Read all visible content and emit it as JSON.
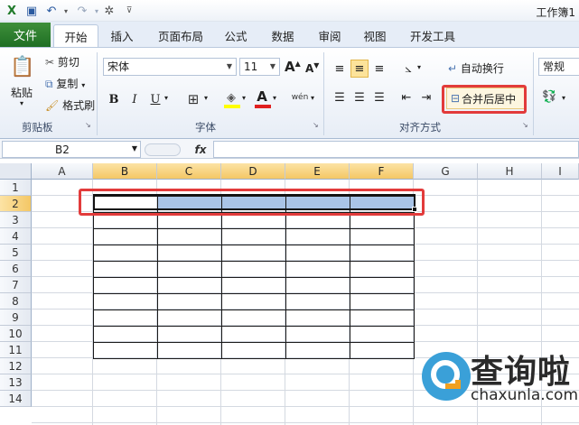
{
  "window": {
    "title": "工作簿1"
  },
  "tabs": [
    {
      "label": "文件"
    },
    {
      "label": "开始"
    },
    {
      "label": "插入"
    },
    {
      "label": "页面布局"
    },
    {
      "label": "公式"
    },
    {
      "label": "数据"
    },
    {
      "label": "审阅"
    },
    {
      "label": "视图"
    },
    {
      "label": "开发工具"
    }
  ],
  "clipboard": {
    "paste_label": "粘贴",
    "cut_label": "剪切",
    "copy_label": "复制",
    "format_painter_label": "格式刷",
    "group_label": "剪贴板"
  },
  "font": {
    "name_value": "宋体",
    "size_value": "11",
    "bold": "B",
    "italic": "I",
    "underline": "U",
    "grow": "A",
    "shrink": "A",
    "font_color_glyph": "A",
    "phonetic_glyph": "wén",
    "group_label": "字体"
  },
  "alignment": {
    "wrap_text_label": "自动换行",
    "merge_center_label": "合并后居中",
    "group_label": "对齐方式"
  },
  "number": {
    "format_value": "常规"
  },
  "formula_bar": {
    "name_box_value": "B2",
    "fx_label": "fx",
    "formula_value": ""
  },
  "grid": {
    "columns": [
      "A",
      "B",
      "C",
      "D",
      "E",
      "F",
      "G",
      "H",
      "I"
    ],
    "selected_columns": [
      "B",
      "C",
      "D",
      "E",
      "F"
    ],
    "rows": [
      "1",
      "2",
      "3",
      "4",
      "5",
      "6",
      "7",
      "8",
      "9",
      "10",
      "11",
      "12",
      "13",
      "14"
    ],
    "selected_row": "2"
  },
  "watermark": {
    "title": "查询啦",
    "url": "chaxunla.com",
    "logo_color": "#3aa0d8"
  },
  "colors": {
    "file_tab": "#2a7d2e",
    "selection_fill": "#a9c4e7",
    "highlight_red": "#e23b3b",
    "selected_header": "#f4c765"
  }
}
